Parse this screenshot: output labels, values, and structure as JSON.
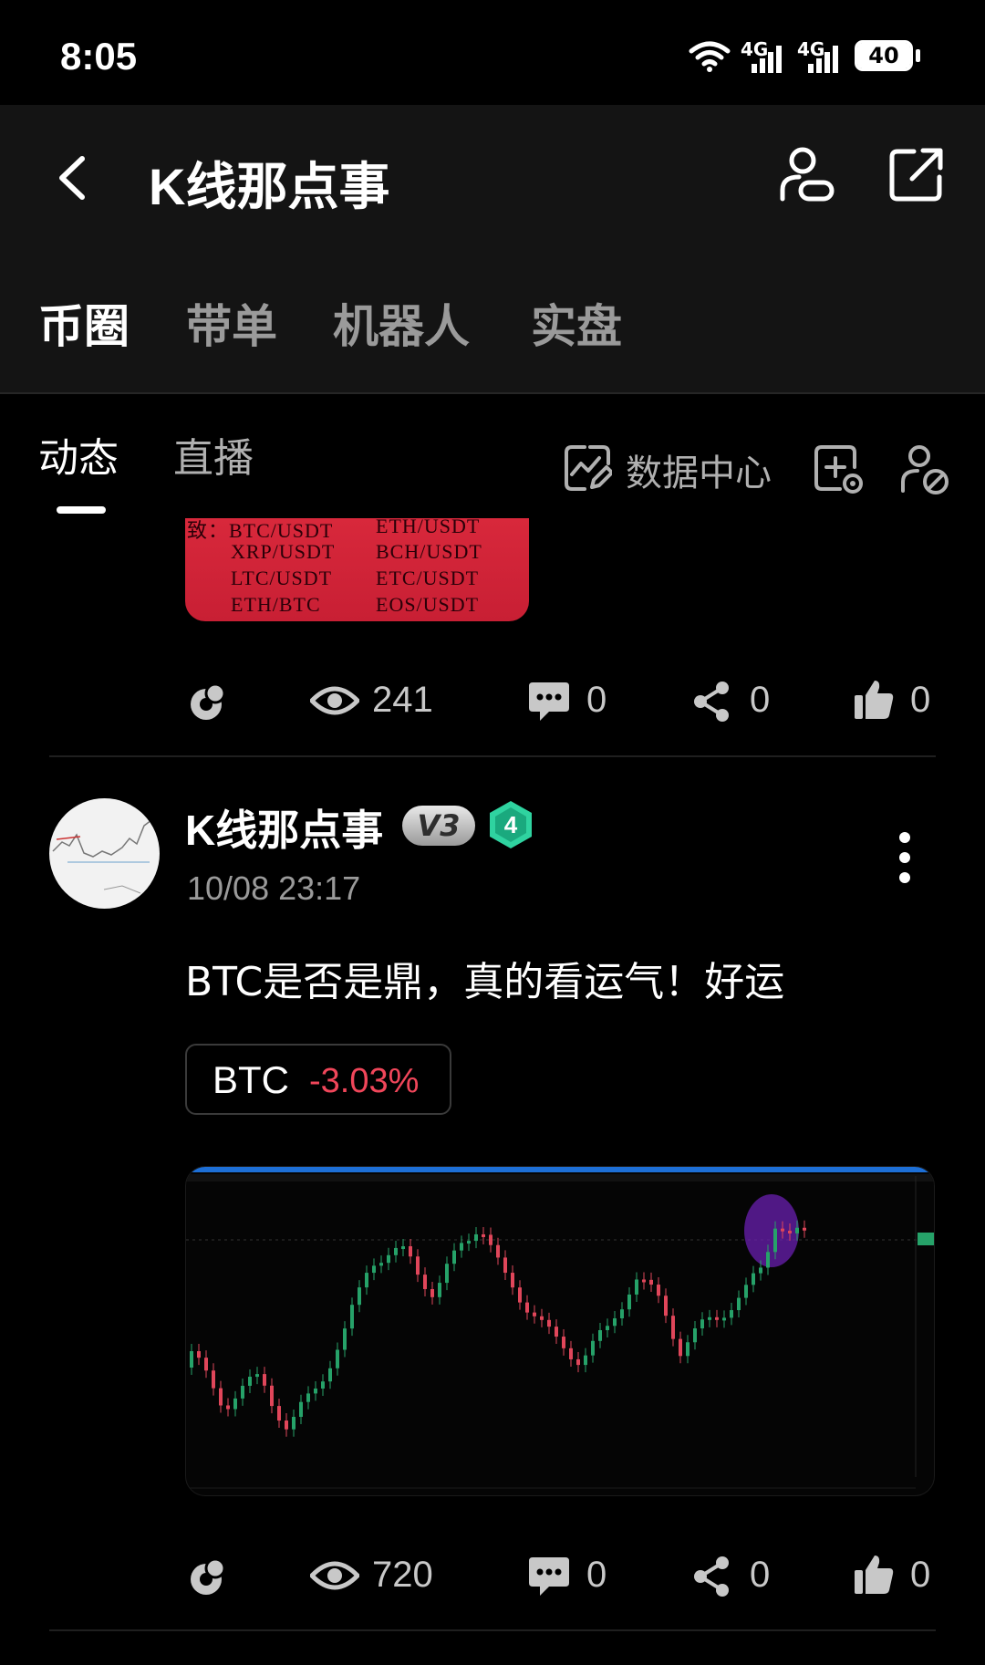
{
  "status_bar": {
    "time": "8:05",
    "signal_1_label": "4G",
    "signal_2_label": "4G",
    "battery": "40",
    "icons": [
      "wifi-icon",
      "signal-icon",
      "signal-icon",
      "battery-icon"
    ]
  },
  "header": {
    "title": "K线那点事",
    "icons": [
      "back-icon",
      "user-card-icon",
      "share-out-icon"
    ],
    "category_tabs": [
      {
        "label": "币圈",
        "active": true
      },
      {
        "label": "带单",
        "active": false
      },
      {
        "label": "机器人",
        "active": false
      },
      {
        "label": "实盘",
        "active": false
      }
    ]
  },
  "sub_tabs": [
    {
      "label": "动态",
      "active": true
    },
    {
      "label": "直播",
      "active": false
    }
  ],
  "toolbar": {
    "data_center_label": "数据中心",
    "icons": [
      "chart-edit-icon",
      "add-post-icon",
      "user-settings-icon"
    ]
  },
  "post1": {
    "image_pairs": [
      [
        "致：BTC/USDT",
        "ETH/USDT"
      ],
      [
        "XRP/USDT",
        "BCH/USDT"
      ],
      [
        "LTC/USDT",
        "ETC/USDT"
      ],
      [
        "ETH/BTC",
        "EOS/USDT"
      ]
    ],
    "actions": {
      "views": "241",
      "comments": "0",
      "shares": "0",
      "likes": "0"
    }
  },
  "post2": {
    "author": "K线那点事",
    "vip_badge": "V3",
    "level_badge": "4",
    "time": "10/08 23:17",
    "text": "BTC是否是鼎，真的看运气！好运",
    "ticker": {
      "symbol": "BTC",
      "change": "-3.03%"
    },
    "actions": {
      "views": "720",
      "comments": "0",
      "shares": "0",
      "likes": "0"
    }
  },
  "colors": {
    "background": "#000000",
    "header_bg": "#141414",
    "negative": "#f0465a",
    "level_badge": "#2fd3a0",
    "candle_up": "#26a269",
    "candle_down": "#e0465a",
    "highlight_circle": "#6a1fb0"
  }
}
